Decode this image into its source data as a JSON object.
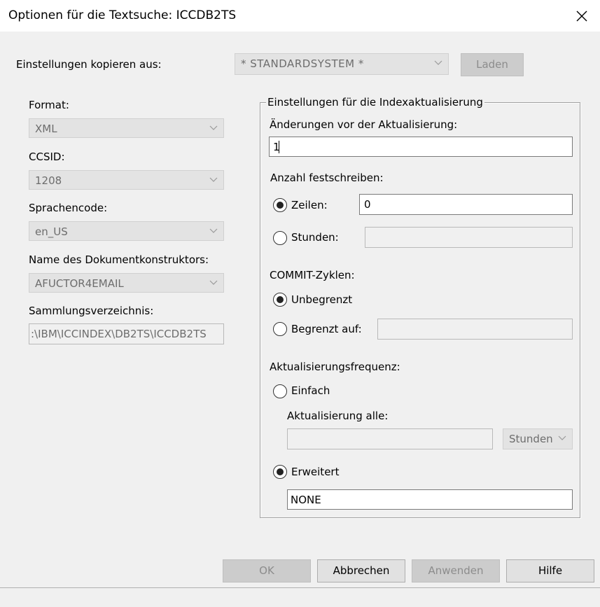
{
  "window": {
    "title": "Optionen für die Textsuche: ICCDB2TS",
    "close_label": "×"
  },
  "copy_settings": {
    "label": "Einstellungen kopieren aus:",
    "value": "* STANDARDSYSTEM *",
    "load_button": "Laden"
  },
  "left": {
    "format_label": "Format:",
    "format_value": "XML",
    "ccsid_label": "CCSID:",
    "ccsid_value": "1208",
    "language_label": "Sprachencode:",
    "language_value": "en_US",
    "doc_constructor_label": "Name des Dokumentkonstruktors:",
    "doc_constructor_value": "AFUCTOR4EMAIL",
    "collection_dir_label": "Sammlungsverzeichnis:",
    "collection_dir_value": ":\\IBM\\ICCINDEX\\DB2TS\\ICCDB2TS"
  },
  "index_update": {
    "group_title": "Einstellungen für die Indexaktualisierung",
    "changes_label": "Änderungen vor der Aktualisierung:",
    "changes_value": "1",
    "commit_count_label": "Anzahl festschreiben:",
    "rows_label": "Zeilen:",
    "rows_value": "0",
    "rows_selected": true,
    "hours_label": "Stunden:",
    "hours_value": "",
    "hours_selected": false,
    "commit_cycles_label": "COMMIT-Zyklen:",
    "unlimited_label": "Unbegrenzt",
    "unlimited_selected": true,
    "limited_label": "Begrenzt auf:",
    "limited_value": "",
    "limited_selected": false,
    "frequency_label": "Aktualisierungsfrequenz:",
    "simple_label": "Einfach",
    "simple_selected": false,
    "update_every_label": "Aktualisierung alle:",
    "update_every_value": "",
    "update_unit": "Stunden",
    "extended_label": "Erweitert",
    "extended_selected": true,
    "extended_value": "NONE"
  },
  "buttons": {
    "ok": "OK",
    "cancel": "Abbrechen",
    "apply": "Anwenden",
    "help": "Hilfe"
  }
}
